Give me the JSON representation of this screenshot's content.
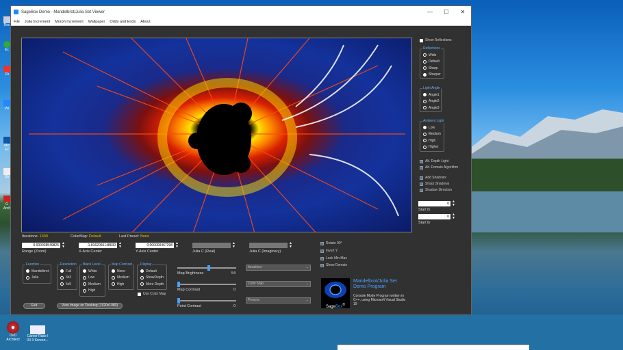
{
  "desktop": {
    "icons": [
      {
        "label": "Rec"
      },
      {
        "label": "Ec"
      },
      {
        "label": "Ch"
      },
      {
        "label": "Wi"
      },
      {
        "label": "Mic Ec"
      },
      {
        "label": "Sh"
      },
      {
        "label": "G Arch"
      },
      {
        "label": "DVD Architect"
      },
      {
        "label": "Career Race I 03 3 Screen..."
      }
    ]
  },
  "window": {
    "title": "SageBox Demo - Mandelbrot/Julia Set Viewer",
    "controls": {
      "minimize": "—",
      "maximize": "☐",
      "close": "✕"
    }
  },
  "menu": [
    "File",
    "Julia Increment",
    "Morph Increment",
    "Wallpaper",
    "Odds and Ends",
    "About"
  ],
  "status": {
    "iterations_label": "Iterations:",
    "iterations_value": "1300",
    "colormap_label": "ColorMap:",
    "colormap_value": "Default",
    "preset_label": "Last Preset:",
    "preset_value": "None"
  },
  "fields": {
    "range": {
      "value": "0.000028549826",
      "label": "Range (Zoom)"
    },
    "xcenter": {
      "value": "-1.8162065148639",
      "label": "X-Axis Center"
    },
    "ycenter": {
      "value": "0.000000467298",
      "label": "Y-Axis Center"
    },
    "juliareal": {
      "value": "",
      "label": "Julia C (Real)"
    },
    "juliaimag": {
      "value": "",
      "label": "Julia C (Imaginary)"
    }
  },
  "function_group": {
    "title": "Function",
    "options": [
      "Mandelbrot",
      "Julia"
    ],
    "selected": 0
  },
  "resolution_group": {
    "title": "Resolution",
    "options": [
      "Full",
      "3x3",
      "5x5"
    ],
    "selected": 0
  },
  "blacklevel_group": {
    "title": "Black Level",
    "options": [
      "White",
      "Low",
      "Medium",
      "High"
    ],
    "selected": 0
  },
  "mapcontrast_group": {
    "title": "Map Contrast",
    "options": [
      "None",
      "Medium",
      "High"
    ],
    "selected": 0
  },
  "display_group": {
    "title": "Display",
    "options": [
      "Default",
      "ShowDepth",
      "More Depth"
    ],
    "selected": 0
  },
  "use_color_map": "Use Color Map",
  "buttons": {
    "exit": "Exit",
    "view": "View Image on Desktop (1920x1080)"
  },
  "sliders": {
    "brightness": {
      "label": "Map Brightness",
      "value": "54",
      "level": 0.54
    },
    "contrast": {
      "label": "Map Contrast",
      "value": "0",
      "level": 0.0
    },
    "pointcontrast": {
      "label": "Point Contrast",
      "value": "0",
      "level": 0.0
    }
  },
  "dropdowns": [
    "Iterations",
    "Color Map",
    "Presets"
  ],
  "mid_checks": [
    "Rotate 90°",
    "Invert Y",
    "Lock Min Max",
    "Show Domain"
  ],
  "sagebox_panel": {
    "title": "Mandelbrot/Julia Set Demo Program",
    "desc": "Console Mode Program written in C++, using Microsoft Visual Studio 19",
    "logo_a": "Sage",
    "logo_b": "Box",
    "logo_tm": "®"
  },
  "right_panel": {
    "show_reflections": "Show Reflections",
    "reflections": {
      "title": "Reflections",
      "options": [
        "Wide",
        "Default",
        "Sharp",
        "Sharper"
      ],
      "selected": 3
    },
    "light_angle": {
      "title": "Light Angle",
      "options": [
        "Angle1",
        "Angle2",
        "Angle3"
      ],
      "selected": 0
    },
    "ambient": {
      "title": "Ambient Light",
      "options": [
        "Low",
        "Medium",
        "High",
        "Higher"
      ],
      "selected": 0
    },
    "checks1": [
      "Alt. Depth Light",
      "Alt. Domain Algorithm"
    ],
    "checks2": [
      "Add Shadows",
      "Sharp Shadows",
      "Shadow Direction"
    ],
    "start_fx": {
      "value": "0",
      "label": "Start fx"
    },
    "start_fy": {
      "value": "0",
      "label": "Start fy"
    }
  },
  "colors": {
    "accent": "#4aa0ff",
    "highlight": "#e0c000",
    "window_bg": "#313131"
  }
}
